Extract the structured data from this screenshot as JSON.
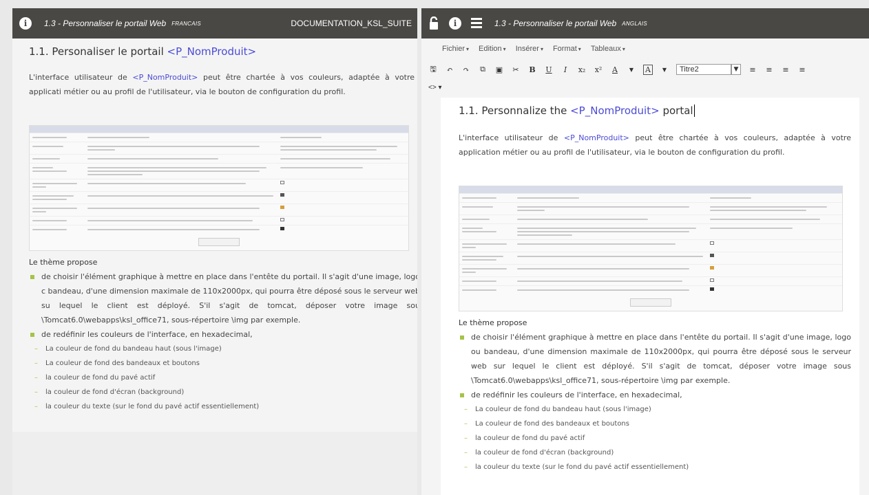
{
  "left": {
    "title": "1.3 - Personnaliser le portail Web",
    "lang": "FRANCAIS",
    "doc": "DOCUMENTATION_KSL_SUITE",
    "info_icon": "info-icon"
  },
  "right": {
    "title": "1.3 - Personnaliser le portail Web",
    "lang": "ANGLAIS",
    "icons": [
      "lock-icon",
      "info-icon",
      "list-icon"
    ],
    "menu": [
      "Fichier",
      "Edition",
      "Insérer",
      "Format",
      "Tableaux"
    ],
    "style_select": "Titre2",
    "code_label": "<>"
  },
  "doc_left": {
    "heading_prefix": "1.1. Personaliser le portail",
    "heading_prod": "<P_NomProduit>",
    "intro_a": "L'interface utilisateur de",
    "intro_prod": "<P_NomProduit>",
    "intro_b": "peut être chartée à vos couleurs, adaptée à votre applicati métier ou au profil de l'utilisateur, via le bouton de configuration du profil.",
    "theme": "Le thème propose",
    "bullet1": "de choisir l'élément graphique à mettre en place dans l'entête du portail. Il s'agit d'une image, logo c bandeau, d'une dimension maximale de 110x2000px, qui pourra être déposé sous le serveur web su lequel le client est déployé. S'il s'agit de tomcat, déposer votre image sou \\Tomcat6.0\\webapps\\ksl_office71, sous-répertoire \\img par exemple.",
    "bullet2": "de redéfinir les couleurs de l'interface, en hexadecimal,",
    "dashes": [
      "La couleur de fond du bandeau haut (sous l'image)",
      "La couleur de fond des bandeaux et boutons",
      "la couleur de fond du pavé actif",
      "la couleur de fond d'écran (background)",
      "la couleur du texte (sur le fond du pavé actif essentiellement)"
    ]
  },
  "doc_right": {
    "heading_prefix": "1.1. Personnalize the",
    "heading_prod": "<P_NomProduit>",
    "heading_suffix": "portal",
    "intro_a": "L'interface utilisateur de",
    "intro_prod": "<P_NomProduit>",
    "intro_b": "peut être chartée à vos couleurs, adaptée à votre application métier ou au profil de l'utilisateur, via le bouton de configuration du profil.",
    "theme": "Le thème propose",
    "bullet1": "de choisir l'élément graphique à mettre en place dans l'entête du portail. Il s'agit d'une image, logo ou bandeau, d'une dimension maximale de 110x2000px, qui pourra être déposé sous le serveur web sur lequel le client est déployé. S'il s'agit de tomcat, déposer votre image sous \\Tomcat6.0\\webapps\\ksl_office71, sous-répertoire \\img par exemple.",
    "bullet2": "de redéfinir les couleurs de l'interface, en hexadecimal,",
    "dashes": [
      "La couleur de fond du bandeau haut (sous l'image)",
      "La couleur de fond des bandeaux et boutons",
      "la couleur de fond du pavé actif",
      "la couleur de fond d'écran (background)",
      "la couleur du texte (sur le fond du pavé actif essentiellement)"
    ]
  },
  "colors": {
    "topbar": "#4a4845",
    "link": "#4b4bd6",
    "bullet": "#a5c446"
  }
}
